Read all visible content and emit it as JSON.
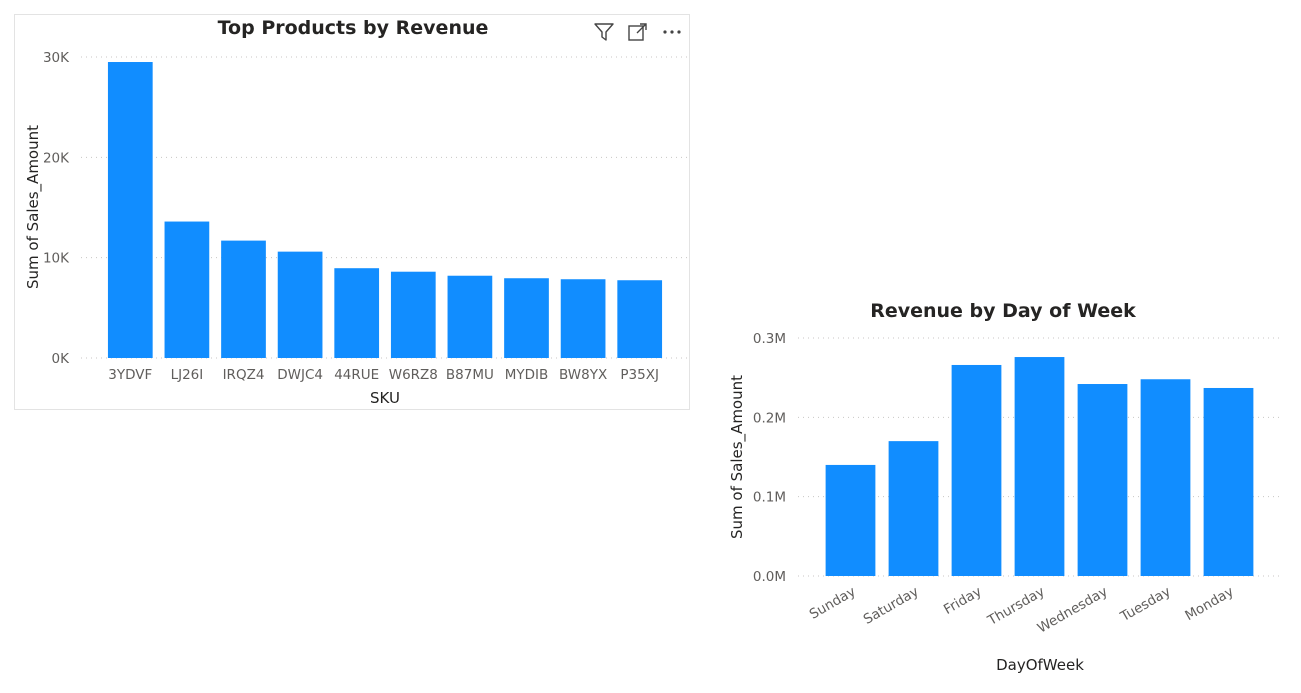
{
  "toolbar": {
    "icons": [
      "filter-icon",
      "focus-mode-icon",
      "more-options-icon"
    ]
  },
  "colors": {
    "bar": "#118dff",
    "grid": "#c8c6c4",
    "text": "#252423",
    "tick": "#605e5c"
  },
  "chart_data": [
    {
      "type": "bar",
      "title": "Top Products by Revenue",
      "xlabel": "SKU",
      "ylabel": "Sum of Sales_Amount",
      "categories": [
        "3YDVF",
        "LJ26I",
        "IRQZ4",
        "DWJC4",
        "44RUE",
        "W6RZ8",
        "B87MU",
        "MYDIB",
        "BW8YX",
        "P35XJ"
      ],
      "values": [
        29500,
        13600,
        11700,
        10600,
        8950,
        8600,
        8200,
        7950,
        7850,
        7750
      ],
      "ylim": [
        0,
        30000
      ],
      "yticks": [
        0,
        10000,
        20000,
        30000
      ],
      "ytick_labels": [
        "0K",
        "10K",
        "20K",
        "30K"
      ],
      "grid": true,
      "legend": "none"
    },
    {
      "type": "bar",
      "title": "Revenue by Day of Week",
      "xlabel": "DayOfWeek",
      "ylabel": "Sum of Sales_Amount",
      "categories": [
        "Sunday",
        "Saturday",
        "Friday",
        "Thursday",
        "Wednesday",
        "Tuesday",
        "Monday"
      ],
      "values": [
        140000,
        170000,
        266000,
        276000,
        242000,
        248000,
        237000
      ],
      "ylim": [
        0,
        300000
      ],
      "yticks": [
        0,
        100000,
        200000,
        300000
      ],
      "ytick_labels": [
        "0.0M",
        "0.1M",
        "0.2M",
        "0.3M"
      ],
      "grid": true,
      "legend": "none"
    }
  ]
}
